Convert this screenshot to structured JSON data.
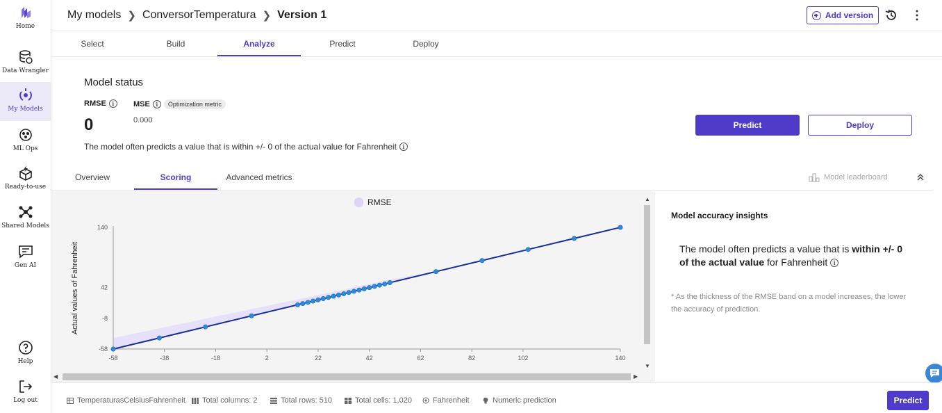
{
  "colors": {
    "accent": "#4f3bc9",
    "band": "#e7e0fa",
    "line": "#1a2e9a",
    "point": "#2b8ad9"
  },
  "sidebar": {
    "items": [
      {
        "label": "Home",
        "icon": "canvas-logo-icon"
      },
      {
        "label": "Data Wrangler",
        "icon": "database-icon"
      },
      {
        "label": "My Models",
        "icon": "models-icon",
        "active": true
      },
      {
        "label": "ML Ops",
        "icon": "ml-ops-icon"
      },
      {
        "label": "Ready-to-use",
        "icon": "ready-to-use-icon"
      },
      {
        "label": "Shared Models",
        "icon": "shared-models-icon"
      },
      {
        "label": "Gen AI",
        "icon": "gen-ai-icon"
      },
      {
        "label": "Help",
        "icon": "help-icon"
      },
      {
        "label": "Log out",
        "icon": "log-out-icon"
      }
    ]
  },
  "header": {
    "breadcrumb": [
      "My models",
      "ConversorTemperatura",
      "Version 1"
    ],
    "add_version_label": "Add version"
  },
  "main_tabs": [
    "Select",
    "Build",
    "Analyze",
    "Predict",
    "Deploy"
  ],
  "active_main_tab": "Analyze",
  "model_status": {
    "title": "Model status",
    "rmse_label": "RMSE",
    "rmse_value": "0",
    "mse_label": "MSE",
    "optimization_badge": "Optimization metric",
    "mse_value": "0.000",
    "sentence": "The model often predicts a value that is within +/- 0 of the actual value for Fahrenheit",
    "predict_label": "Predict",
    "deploy_label": "Deploy"
  },
  "sub_tabs": [
    "Overview",
    "Scoring",
    "Advanced metrics"
  ],
  "active_sub_tab": "Scoring",
  "leaderboard_label": "Model leaderboard",
  "chart_data": {
    "type": "line",
    "legend": [
      "RMSE"
    ],
    "ylabel": "Actual values of Fahrenheit",
    "xlabel": "",
    "x_ticks": [
      "-58",
      "-38",
      "-18",
      "2",
      "22",
      "42",
      "62",
      "82",
      "102",
      "140"
    ],
    "y_ticks": [
      "140",
      "42",
      "-8",
      "-58"
    ],
    "xlim": [
      -58,
      140
    ],
    "ylim": [
      -58,
      140
    ],
    "series": [
      {
        "name": "RMSE",
        "x": [
          -58,
          -40,
          -22,
          -4,
          14,
          16,
          18,
          20,
          22,
          24,
          26,
          28,
          30,
          32,
          34,
          36,
          38,
          40,
          42,
          44,
          46,
          48,
          50,
          68,
          86,
          104,
          122,
          140
        ],
        "y": [
          -58,
          -40,
          -22,
          -4,
          14,
          16,
          18,
          20,
          22,
          24,
          26,
          28,
          30,
          32,
          34,
          36,
          38,
          40,
          42,
          44,
          46,
          48,
          50,
          68,
          86,
          104,
          122,
          140
        ]
      }
    ]
  },
  "insights": {
    "title": "Model accuracy insights",
    "pre": "The model often predicts a value that is ",
    "bold": "within +/- 0 of the actual value",
    "post": " for Fahrenheit",
    "note": "* As the thickness of the RMSE band on a model increases, the lower the accuracy of prediction."
  },
  "footer": {
    "dataset": "TemperaturasCelsiusFahrenheit",
    "columns": "Total columns: 2",
    "rows": "Total rows: 510",
    "cells": "Total cells: 1,020",
    "target": "Fahrenheit",
    "type": "Numeric prediction",
    "predict_label": "Predict"
  }
}
